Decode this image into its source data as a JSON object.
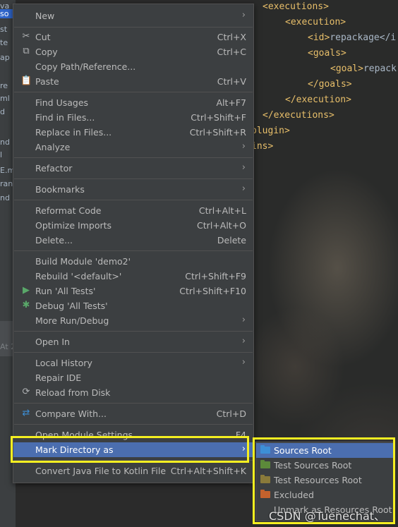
{
  "background": {
    "tree_fragments": [
      "va",
      "so",
      "st",
      "te",
      "ap",
      "re",
      "ml",
      "d",
      "nd",
      "l",
      "E.m",
      "ran",
      "nd"
    ],
    "status_fragment": "At 2",
    "code_lines": [
      {
        "open": "<",
        "tag": "executions",
        "close": ">",
        "text": ""
      },
      {
        "open": "<",
        "tag": "execution",
        "close": ">",
        "text": ""
      },
      {
        "open": "<",
        "tag": "id",
        "close": ">",
        "text": "repackage</i"
      },
      {
        "open": "<",
        "tag": "goals",
        "close": ">",
        "text": ""
      },
      {
        "open": "<",
        "tag": "goal",
        "close": ">",
        "text": "repack"
      },
      {
        "open": "</",
        "tag": "goals",
        "close": ">",
        "text": ""
      },
      {
        "open": "</",
        "tag": "execution",
        "close": ">",
        "text": ""
      },
      {
        "open": "</",
        "tag": "executions",
        "close": ">",
        "text": ""
      },
      {
        "open": "",
        "tag": "plugin",
        "close": ">",
        "text": ""
      },
      {
        "open": "",
        "tag": "ins",
        "close": ">",
        "text": ""
      }
    ]
  },
  "menu": {
    "items": [
      {
        "label": "New",
        "shortcut": "",
        "submenu": true,
        "icon": ""
      },
      {
        "label": "Cut",
        "shortcut": "Ctrl+X",
        "submenu": false,
        "icon": "scissors-icon"
      },
      {
        "label": "Copy",
        "shortcut": "Ctrl+C",
        "submenu": false,
        "icon": "copy-icon"
      },
      {
        "label": "Copy Path/Reference...",
        "shortcut": "",
        "submenu": false,
        "icon": ""
      },
      {
        "label": "Paste",
        "shortcut": "Ctrl+V",
        "submenu": false,
        "icon": "paste-icon"
      },
      {
        "label": "Find Usages",
        "shortcut": "Alt+F7",
        "submenu": false,
        "icon": ""
      },
      {
        "label": "Find in Files...",
        "shortcut": "Ctrl+Shift+F",
        "submenu": false,
        "icon": ""
      },
      {
        "label": "Replace in Files...",
        "shortcut": "Ctrl+Shift+R",
        "submenu": false,
        "icon": ""
      },
      {
        "label": "Analyze",
        "shortcut": "",
        "submenu": true,
        "icon": ""
      },
      {
        "label": "Refactor",
        "shortcut": "",
        "submenu": true,
        "icon": ""
      },
      {
        "label": "Bookmarks",
        "shortcut": "",
        "submenu": true,
        "icon": ""
      },
      {
        "label": "Reformat Code",
        "shortcut": "Ctrl+Alt+L",
        "submenu": false,
        "icon": ""
      },
      {
        "label": "Optimize Imports",
        "shortcut": "Ctrl+Alt+O",
        "submenu": false,
        "icon": ""
      },
      {
        "label": "Delete...",
        "shortcut": "Delete",
        "submenu": false,
        "icon": ""
      },
      {
        "label": "Build Module 'demo2'",
        "shortcut": "",
        "submenu": false,
        "icon": ""
      },
      {
        "label": "Rebuild '<default>'",
        "shortcut": "Ctrl+Shift+F9",
        "submenu": false,
        "icon": ""
      },
      {
        "label": "Run 'All Tests'",
        "shortcut": "Ctrl+Shift+F10",
        "submenu": false,
        "icon": "run-icon"
      },
      {
        "label": "Debug 'All Tests'",
        "shortcut": "",
        "submenu": false,
        "icon": "debug-icon"
      },
      {
        "label": "More Run/Debug",
        "shortcut": "",
        "submenu": true,
        "icon": ""
      },
      {
        "label": "Open In",
        "shortcut": "",
        "submenu": true,
        "icon": ""
      },
      {
        "label": "Local History",
        "shortcut": "",
        "submenu": true,
        "icon": ""
      },
      {
        "label": "Repair IDE",
        "shortcut": "",
        "submenu": false,
        "icon": ""
      },
      {
        "label": "Reload from Disk",
        "shortcut": "",
        "submenu": false,
        "icon": "reload-icon"
      },
      {
        "label": "Compare With...",
        "shortcut": "Ctrl+D",
        "submenu": false,
        "icon": "compare-icon"
      },
      {
        "label": "Open Module Settings",
        "shortcut": "F4",
        "submenu": false,
        "icon": ""
      },
      {
        "label": "Mark Directory as",
        "shortcut": "",
        "submenu": true,
        "icon": ""
      },
      {
        "label": "Convert Java File to Kotlin File",
        "shortcut": "Ctrl+Alt+Shift+K",
        "submenu": false,
        "icon": ""
      }
    ],
    "highlighted_index": 25,
    "arrow_glyph": "›"
  },
  "submenu": {
    "items": [
      {
        "label": "Sources Root",
        "folder_color": "#3d8fd6"
      },
      {
        "label": "Test Sources Root",
        "folder_color": "#5c8a3a"
      },
      {
        "label": "Test Resources Root",
        "folder_color": "#8a7a3a"
      },
      {
        "label": "Excluded",
        "folder_color": "#c4622d"
      },
      {
        "label": "Unmark as Resources Root",
        "folder_color": ""
      }
    ],
    "highlighted_index": 0
  },
  "watermark": "CSDN @Tuenechat、",
  "colors": {
    "menu_bg": "#3c3f41",
    "highlight": "#4b6eaf",
    "annotation_box": "#f5ef21",
    "xml_tag": "#e8bf6a"
  }
}
